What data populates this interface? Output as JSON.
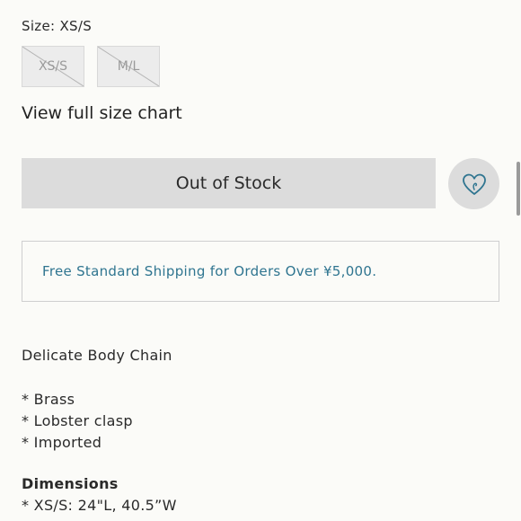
{
  "size": {
    "label": "Size:",
    "selected": "XS/S",
    "options": [
      {
        "label": "XS/S",
        "available": false
      },
      {
        "label": "M/L",
        "available": false
      }
    ]
  },
  "size_chart_link": "View full size chart",
  "stock_button": "Out of Stock",
  "wishlist_icon": "heart-icon",
  "shipping_message": "Free Standard Shipping for Orders Over ¥5,000.",
  "description": {
    "title": "Delicate Body Chain",
    "features": [
      "* Brass",
      "* Lobster clasp",
      "* Imported"
    ],
    "dimensions_heading": "Dimensions",
    "dimensions": [
      "* XS/S: 24\"L, 40.5”W"
    ]
  },
  "colors": {
    "accent": "#2f7590",
    "button_bg": "#dcdcdc",
    "page_bg": "#fbfbf8"
  }
}
